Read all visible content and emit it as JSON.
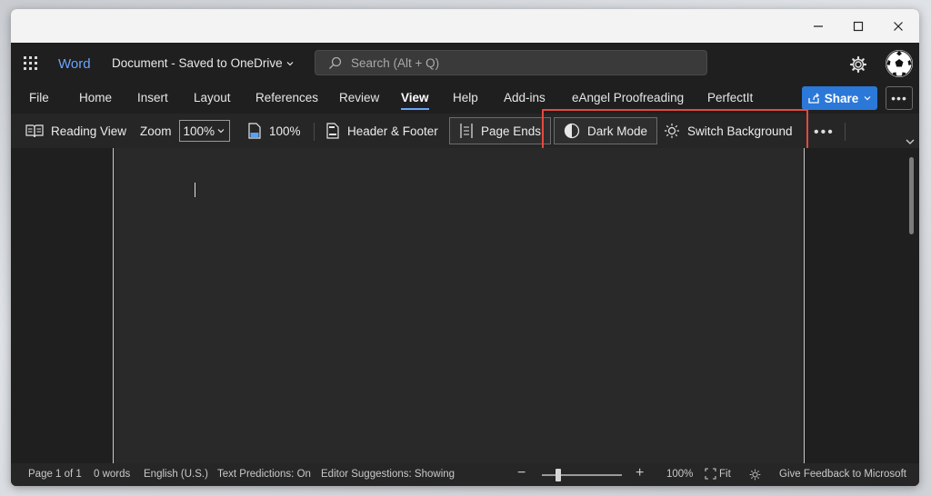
{
  "app": {
    "name": "Word",
    "document_title": "Document - Saved to OneDrive",
    "search_placeholder": "Search (Alt + Q)",
    "brand_color": "#2b78d8"
  },
  "tabs": [
    {
      "label": "File"
    },
    {
      "label": "Home"
    },
    {
      "label": "Insert"
    },
    {
      "label": "Layout"
    },
    {
      "label": "References"
    },
    {
      "label": "Review"
    },
    {
      "label": "View",
      "active": true
    },
    {
      "label": "Help"
    },
    {
      "label": "Add-ins"
    },
    {
      "label": "eAngel Proofreading"
    },
    {
      "label": "PerfectIt"
    }
  ],
  "share_label": "Share",
  "ribbon": {
    "reading_view": "Reading View",
    "zoom_label": "Zoom",
    "zoom_value": "100%",
    "zoom_100": "100%",
    "header_footer": "Header & Footer",
    "page_ends": "Page Ends",
    "dark_mode": "Dark Mode",
    "switch_background": "Switch Background"
  },
  "status": {
    "page": "Page 1 of 1",
    "words": "0 words",
    "language": "English (U.S.)",
    "text_predictions": "Text Predictions: On",
    "editor_suggestions": "Editor Suggestions: Showing",
    "zoom": "100%",
    "fit": "Fit",
    "feedback": "Give Feedback to Microsoft",
    "zoom_level": 0.2
  }
}
